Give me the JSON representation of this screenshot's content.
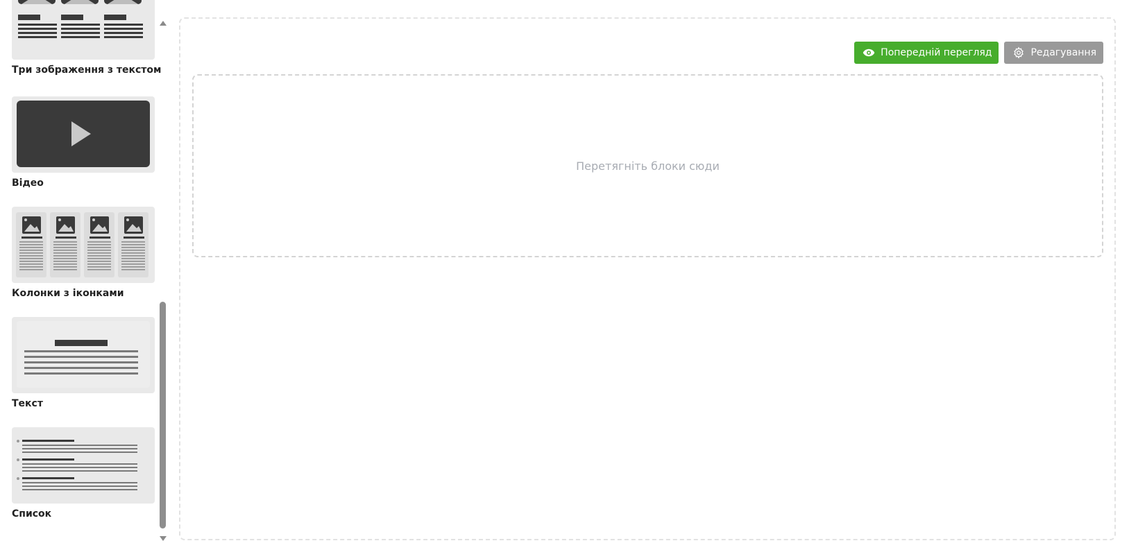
{
  "sidebar": {
    "blocks": [
      {
        "id": "three-images-text",
        "label": "Три зображення з текстом",
        "icon": "three-images-text-icon"
      },
      {
        "id": "video",
        "label": "Відео",
        "icon": "video-play-icon"
      },
      {
        "id": "icon-columns",
        "label": "Колонки з іконками",
        "icon": "icon-columns-icon"
      },
      {
        "id": "text",
        "label": "Текст",
        "icon": "text-block-icon"
      },
      {
        "id": "list",
        "label": "Список",
        "icon": "list-block-icon"
      }
    ]
  },
  "toolbar": {
    "preview_label": "Попередній перегляд",
    "edit_label": "Редагування",
    "preview_color": "#47ad2d",
    "edit_color": "#999999"
  },
  "dropzone": {
    "placeholder": "Перетягніть блоки сюди"
  }
}
